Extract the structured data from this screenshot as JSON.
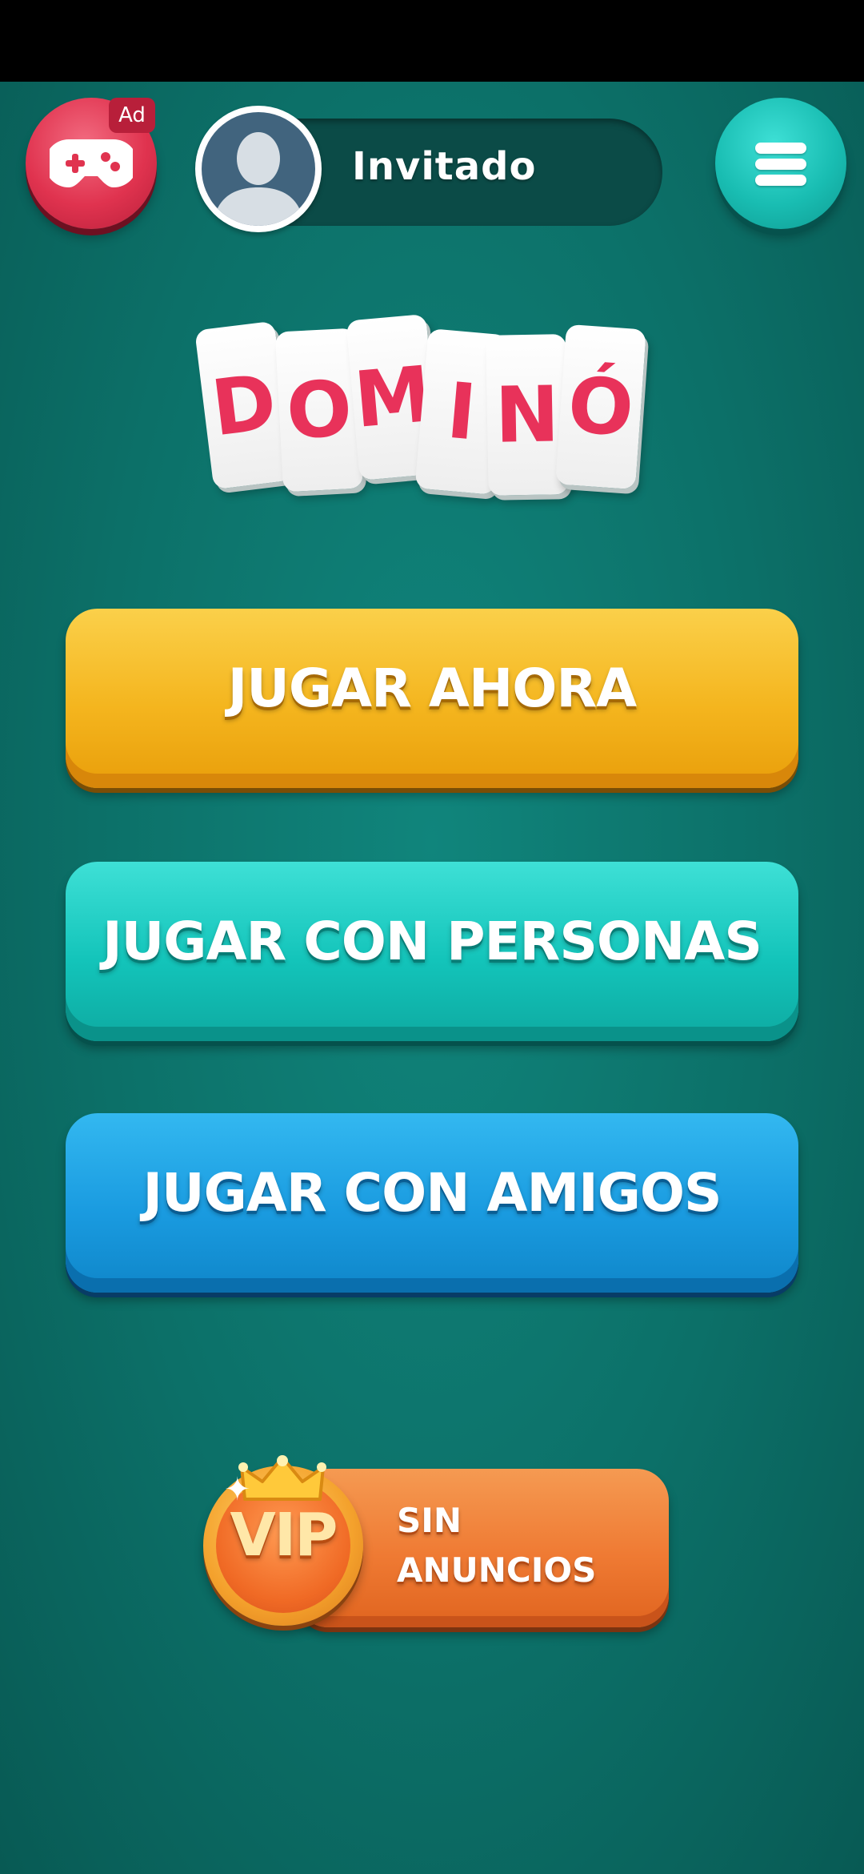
{
  "top_bar": {
    "ad_badge": "Ad",
    "username": "Invitado"
  },
  "logo": {
    "letters": [
      "D",
      "O",
      "M",
      "I",
      "N",
      "Ó"
    ]
  },
  "buttons": {
    "play_now": "JUGAR AHORA",
    "play_people": "JUGAR CON PERSONAS",
    "play_friends": "JUGAR CON AMIGOS"
  },
  "vip": {
    "badge": "VIP",
    "line1": "SIN",
    "line2": "ANUNCIOS"
  },
  "colors": {
    "background": "#0c7068",
    "logo_letters": "#e8325a",
    "play_button": "#f4b51e",
    "people_button": "#13c4ba",
    "friends_button": "#1a9be0",
    "vip_button": "#ef7a33",
    "ad_button": "#e0334f",
    "menu_button": "#19bdb2"
  }
}
